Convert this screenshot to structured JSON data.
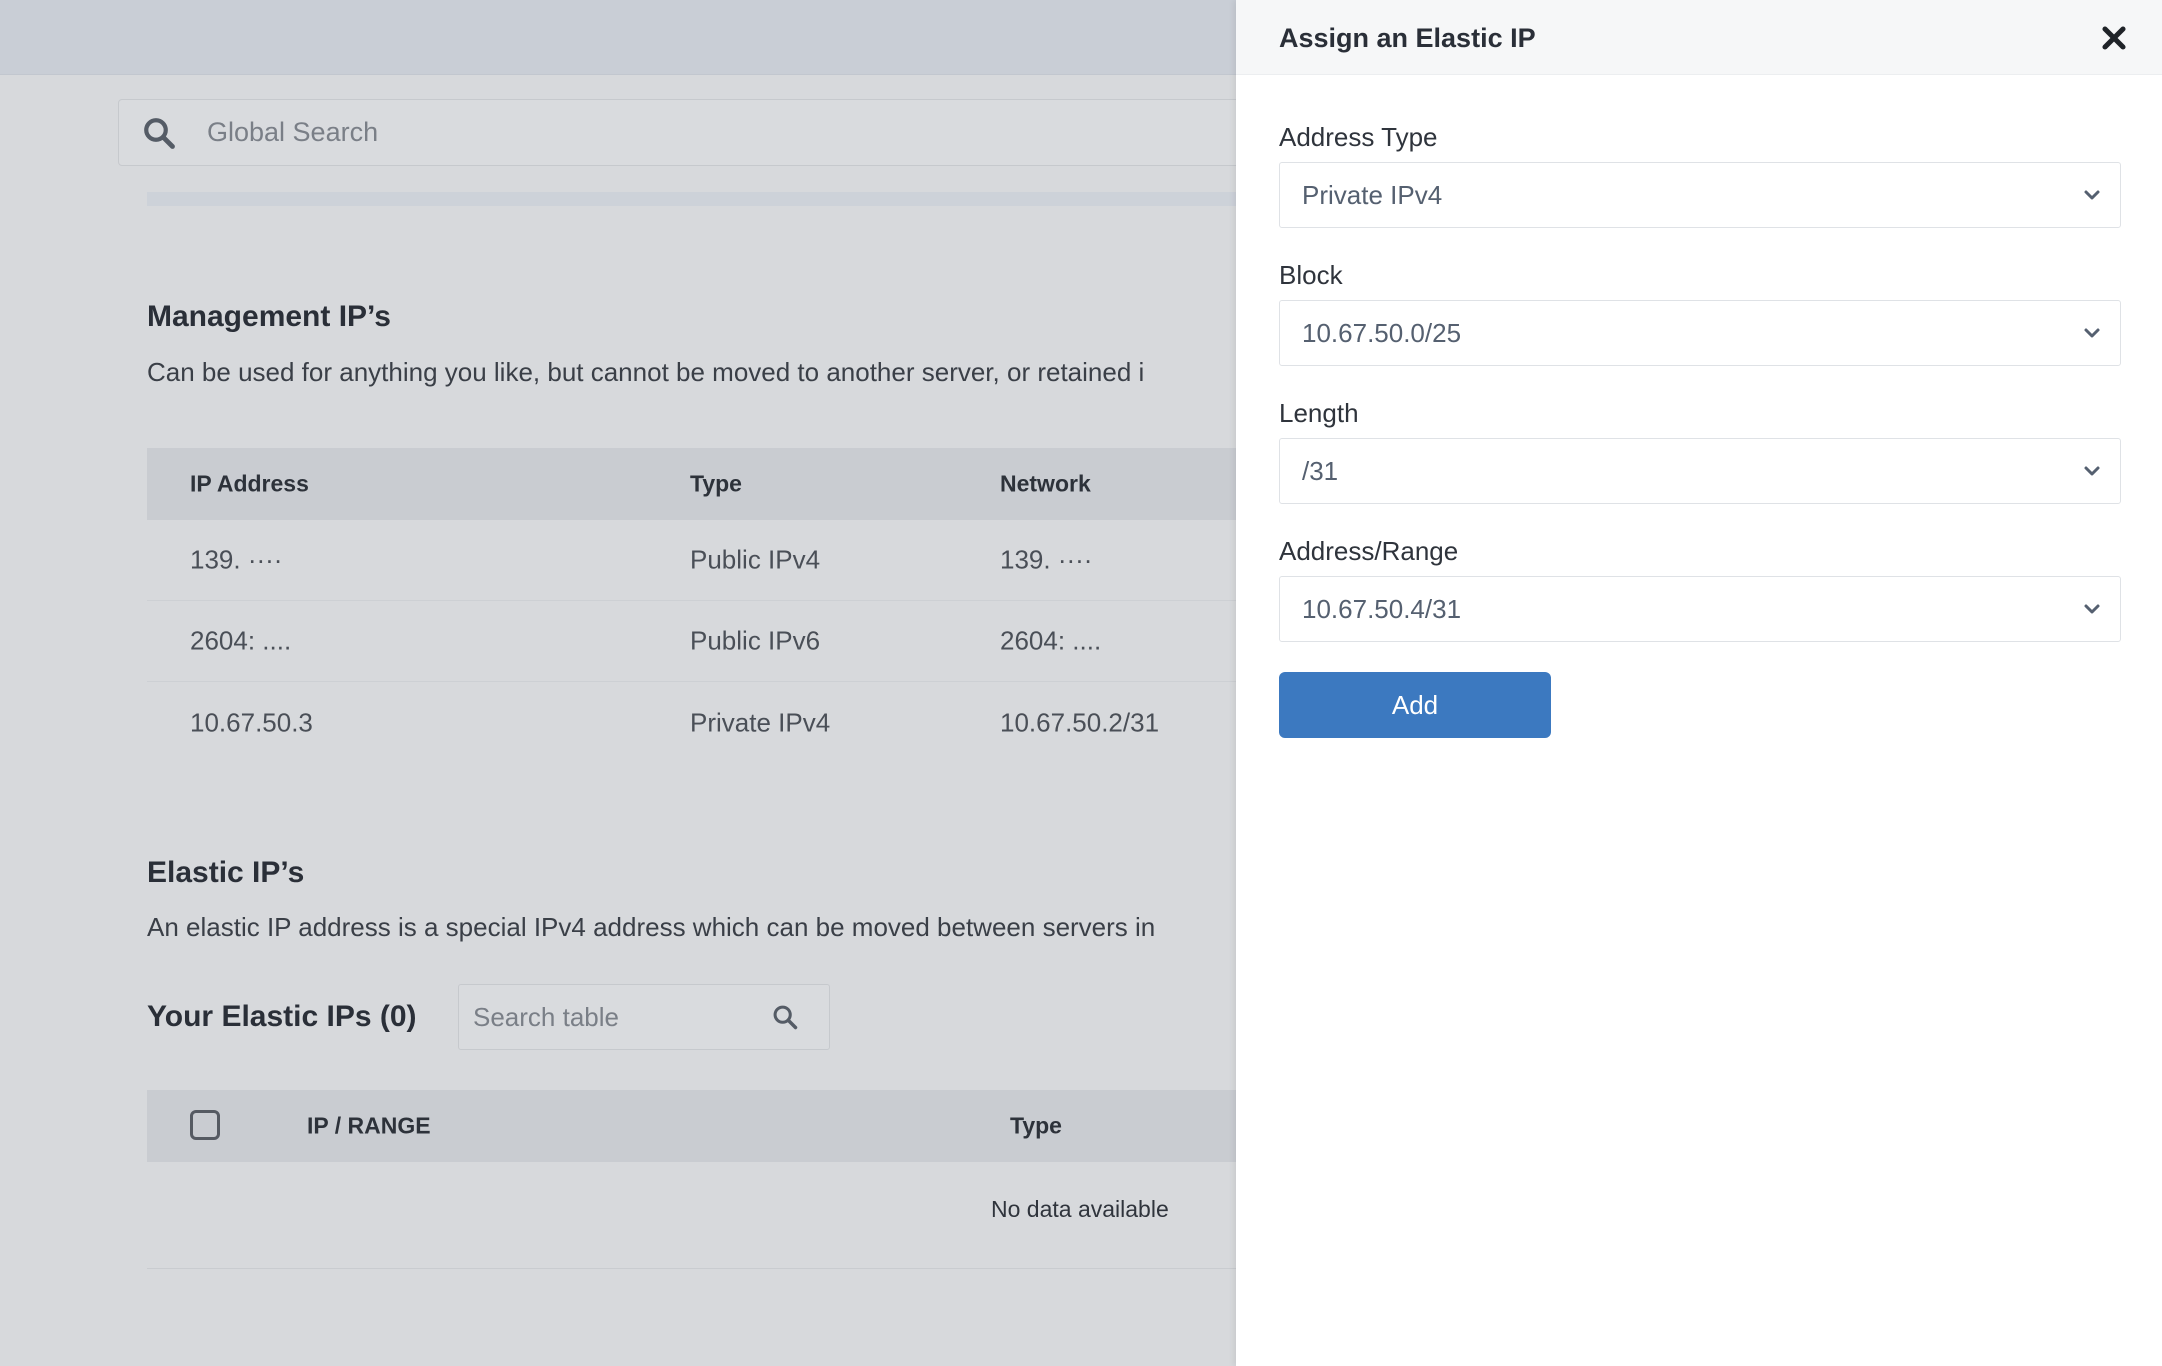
{
  "search": {
    "placeholder": "Global Search"
  },
  "management": {
    "title": "Management IP’s",
    "description": "Can be used for anything you like, but cannot be moved to another server, or retained i",
    "columns": [
      "IP Address",
      "Type",
      "Network"
    ],
    "rows": [
      {
        "ip": "139.  ····",
        "type": "Public IPv4",
        "network": "139.  ····"
      },
      {
        "ip": "2604:  ....",
        "type": "Public IPv6",
        "network": "2604:  ...."
      },
      {
        "ip": "10.67.50.3",
        "type": "Private IPv4",
        "network": "10.67.50.2/31"
      }
    ]
  },
  "elastic": {
    "title": "Elastic IP’s",
    "description": "An elastic IP address is a special IPv4 address which can be moved between servers in",
    "your_title": "Your Elastic IPs (0)",
    "search_placeholder": "Search table",
    "columns": [
      "IP / RANGE",
      "Type"
    ],
    "empty_text": "No data available"
  },
  "drawer": {
    "title": "Assign an Elastic IP",
    "fields": [
      {
        "label": "Address Type",
        "value": "Private IPv4"
      },
      {
        "label": "Block",
        "value": "10.67.50.0/25"
      },
      {
        "label": "Length",
        "value": "/31"
      },
      {
        "label": "Address/Range",
        "value": "10.67.50.4/31"
      }
    ],
    "add_label": "Add"
  },
  "colors": {
    "primary_button": "#3c79c0",
    "overlay_bg": "#d7d9dc",
    "drawer_bg": "#ffffff"
  },
  "icons": [
    "search-icon",
    "close-icon",
    "chevron-down-icon"
  ]
}
